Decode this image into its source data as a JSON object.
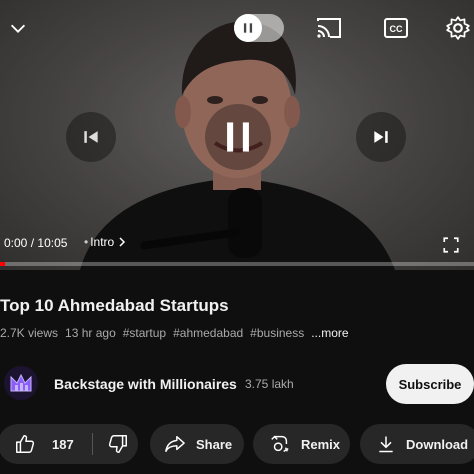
{
  "player": {
    "time_current": "0:00",
    "time_total": "10:05",
    "time_separator": "/",
    "chapter": "Intro",
    "progress_fraction": 0.01
  },
  "video": {
    "title": "Top 10 Ahmedabad Startups",
    "views": "2.7K views",
    "age": "13 hr ago",
    "hashtags": [
      "#startup",
      "#ahmedabad",
      "#business"
    ],
    "more": "...more"
  },
  "channel": {
    "name": "Backstage with Millionaires",
    "subscribers": "3.75 lakh",
    "subscribe_label": "Subscribe"
  },
  "actions": {
    "like_count": "187",
    "share_label": "Share",
    "remix_label": "Remix",
    "download_label": "Download"
  },
  "icons": {
    "collapse": "chevron-down-icon",
    "pause_small": "pause-icon",
    "cast": "cast-icon",
    "captions": "captions-icon",
    "settings": "gear-icon",
    "previous": "skip-previous-icon",
    "pause": "pause-icon",
    "next": "skip-next-icon",
    "fullscreen": "fullscreen-icon"
  },
  "colors": {
    "background": "#0f0f0f",
    "progress": "#ff0000",
    "subscribe_bg": "#f1f1f1",
    "pill_bg": "#272727"
  }
}
